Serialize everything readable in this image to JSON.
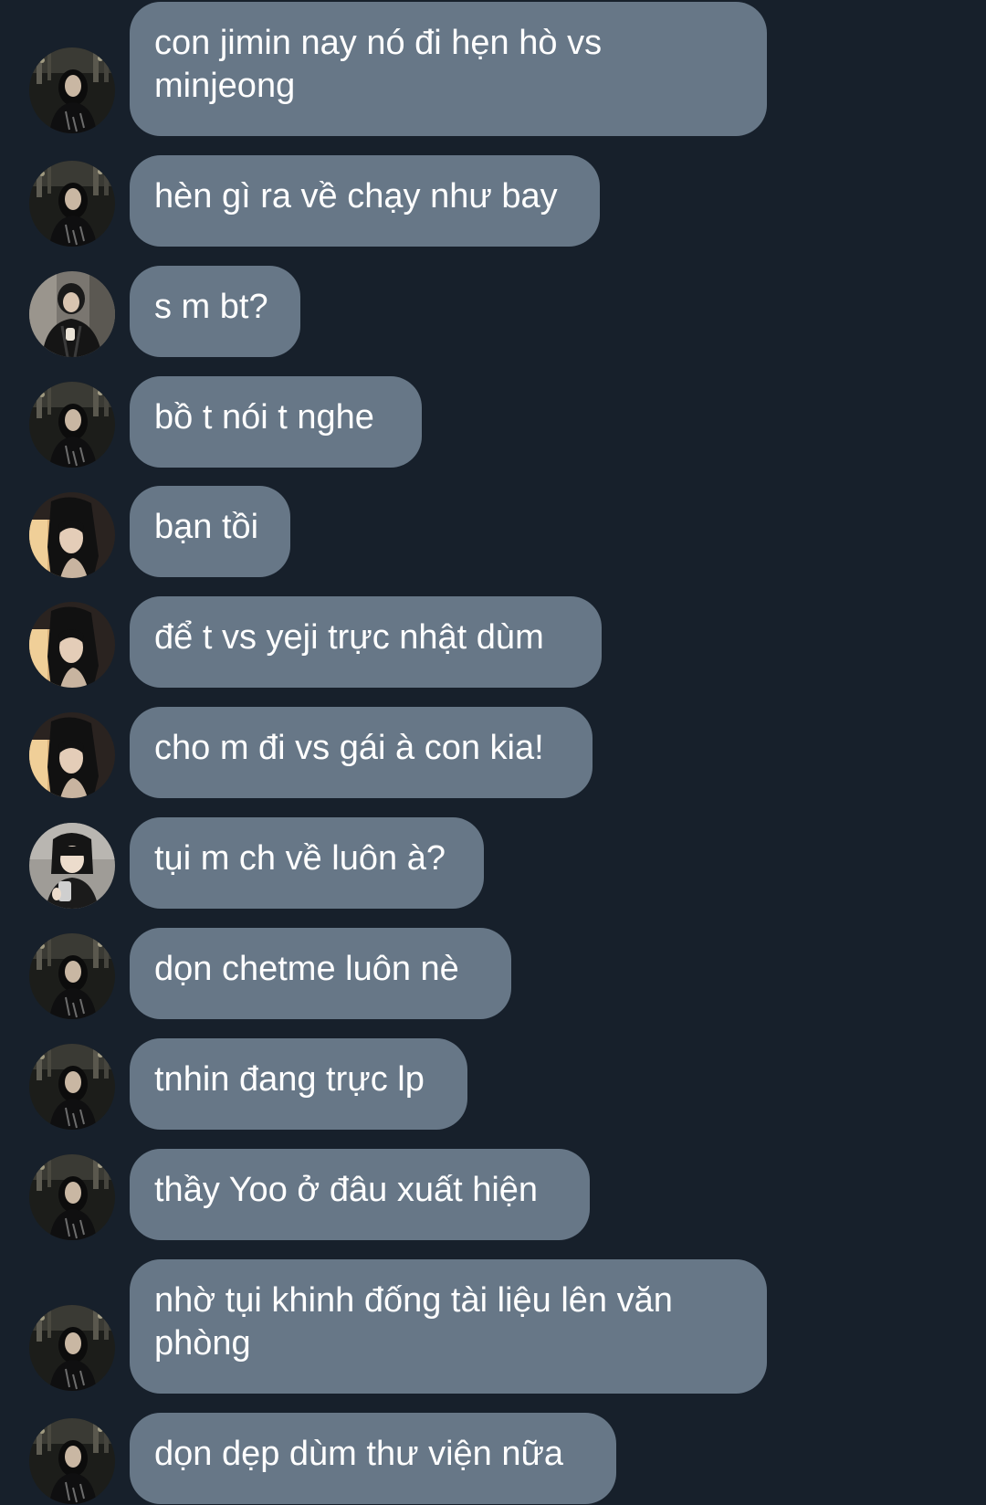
{
  "messages": [
    {
      "text": "con jimin nay nó đi hẹn hò vs minjeong",
      "avatar": "dark-night-portrait"
    },
    {
      "text": "hèn gì ra về chạy như bay",
      "avatar": "dark-night-portrait"
    },
    {
      "text": "s m bt?",
      "avatar": "leather-jacket-portrait"
    },
    {
      "text": "bồ t nói t nghe",
      "avatar": "dark-night-portrait"
    },
    {
      "text": "bạn tồi",
      "avatar": "warm-light-portrait"
    },
    {
      "text": "để t vs yeji trực nhật dùm",
      "avatar": "warm-light-portrait"
    },
    {
      "text": "cho m đi vs gái à con kia!",
      "avatar": "warm-light-portrait"
    },
    {
      "text": "tụi m ch về luôn à?",
      "avatar": "mirror-selfie-portrait"
    },
    {
      "text": "dọn chetme luôn nè",
      "avatar": "dark-night-portrait"
    },
    {
      "text": "tnhin đang trực lp",
      "avatar": "dark-night-portrait"
    },
    {
      "text": "thầy Yoo ở đâu xuất hiện",
      "avatar": "dark-night-portrait"
    },
    {
      "text": "nhờ tụi khinh đống tài liệu lên văn phòng",
      "avatar": "dark-night-portrait"
    },
    {
      "text": "dọn dẹp dùm thư viện nữa",
      "avatar": "dark-night-portrait"
    }
  ]
}
